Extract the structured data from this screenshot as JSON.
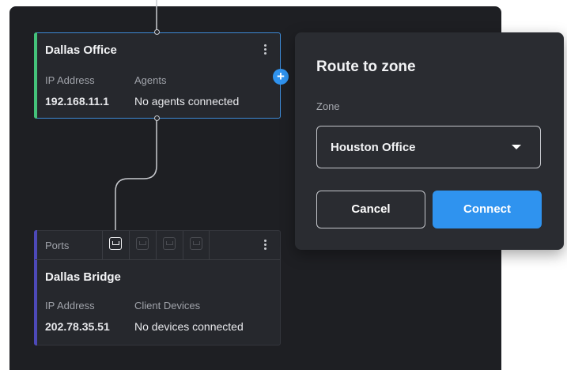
{
  "nodes": {
    "dallas_office": {
      "title": "Dallas Office",
      "ip_label": "IP Address",
      "ip_value": "192.168.11.1",
      "agents_label": "Agents",
      "agents_value": "No agents connected",
      "accent_color": "#44c27a",
      "border_color": "#3d8ad6"
    },
    "dallas_bridge": {
      "ports_label": "Ports",
      "ports_count": 4,
      "active_port": 1,
      "title": "Dallas Bridge",
      "ip_label": "IP Address",
      "ip_value": "202.78.35.51",
      "clients_label": "Client Devices",
      "clients_value": "No devices connected",
      "accent_color": "#4d49b8"
    }
  },
  "add_button": {
    "icon": "plus-icon",
    "label": "+"
  },
  "route_panel": {
    "title": "Route to zone",
    "zone_label": "Zone",
    "zone_value": "Houston Office",
    "cancel_label": "Cancel",
    "connect_label": "Connect",
    "accent_color": "#2f93ef"
  }
}
